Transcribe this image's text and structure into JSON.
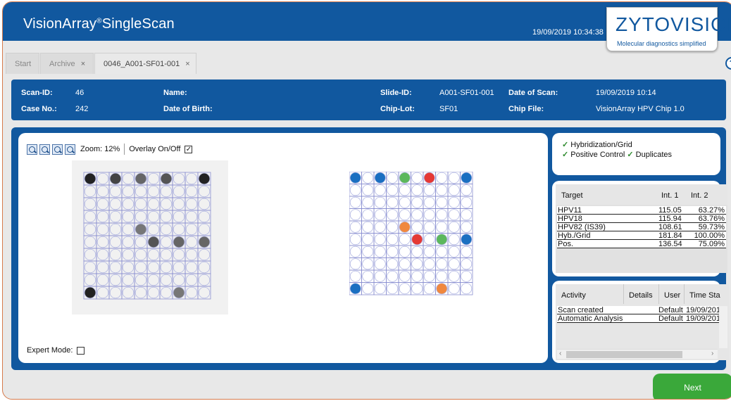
{
  "header": {
    "title": "VisionArray",
    "title_mark": "®",
    "title_suffix": "SingleScan",
    "datetime": "19/09/2019 10:34:38",
    "logo": {
      "word": "ZYTOVISION",
      "tagline": "Molecular diagnostics simplified"
    }
  },
  "tabs": [
    {
      "label": "Start",
      "closable": false,
      "active": false
    },
    {
      "label": "Archive",
      "closable": true,
      "active": false
    },
    {
      "label": "0046_A001-SF01-001",
      "closable": true,
      "active": true
    }
  ],
  "close_glyph": "×",
  "help_label": "?",
  "scan_info": {
    "scan_id_label": "Scan-ID:",
    "scan_id": "46",
    "case_no_label": "Case No.:",
    "case_no": "242",
    "name_label": "Name:",
    "name": "",
    "dob_label": "Date of Birth:",
    "dob": "",
    "slide_id_label": "Slide-ID:",
    "slide_id": "A001-SF01-001",
    "chip_lot_label": "Chip-Lot:",
    "chip_lot": "SF01",
    "date_of_scan_label": "Date of Scan:",
    "date_of_scan": "19/09/2019 10:14",
    "chip_file_label": "Chip File:",
    "chip_file": "VisionArray HPV Chip 1.0"
  },
  "viewer": {
    "zoom_label": "Zoom: 12%",
    "overlay_label": "Overlay On/Off",
    "overlay_checked": true,
    "expert_label": "Expert Mode:",
    "expert_checked": false,
    "grid_rows": 10,
    "grid_cols": 10,
    "raw_spots": [
      {
        "r": 0,
        "c": 0,
        "shade": "#222"
      },
      {
        "r": 0,
        "c": 2,
        "shade": "#444"
      },
      {
        "r": 0,
        "c": 4,
        "shade": "#666"
      },
      {
        "r": 0,
        "c": 6,
        "shade": "#555"
      },
      {
        "r": 0,
        "c": 9,
        "shade": "#222"
      },
      {
        "r": 4,
        "c": 4,
        "shade": "#777"
      },
      {
        "r": 5,
        "c": 5,
        "shade": "#555"
      },
      {
        "r": 5,
        "c": 7,
        "shade": "#666"
      },
      {
        "r": 5,
        "c": 9,
        "shade": "#666"
      },
      {
        "r": 9,
        "c": 0,
        "shade": "#222"
      },
      {
        "r": 9,
        "c": 7,
        "shade": "#777"
      }
    ],
    "spots": [
      {
        "r": 0,
        "c": 0,
        "color": "#1a6fc1"
      },
      {
        "r": 0,
        "c": 2,
        "color": "#1a6fc1"
      },
      {
        "r": 0,
        "c": 4,
        "color": "#5cb85c"
      },
      {
        "r": 0,
        "c": 6,
        "color": "#e53935"
      },
      {
        "r": 0,
        "c": 9,
        "color": "#1a6fc1"
      },
      {
        "r": 4,
        "c": 4,
        "color": "#f0883e"
      },
      {
        "r": 5,
        "c": 5,
        "color": "#e53935"
      },
      {
        "r": 5,
        "c": 7,
        "color": "#5cb85c"
      },
      {
        "r": 5,
        "c": 9,
        "color": "#1a6fc1"
      },
      {
        "r": 9,
        "c": 0,
        "color": "#1a6fc1"
      },
      {
        "r": 9,
        "c": 7,
        "color": "#f0883e"
      }
    ]
  },
  "status": {
    "line1": "Hybridization/Grid",
    "line2a": "Positive Control",
    "line2b": "Duplicates",
    "check_glyph": "✓"
  },
  "target_table": {
    "headers": [
      "Target",
      "Int. 1",
      "Int. 2"
    ],
    "rows": [
      [
        "HPV11",
        "115.05",
        "63.27%"
      ],
      [
        "HPV18",
        "115.94",
        "63.76%"
      ],
      [
        "HPV82 (IS39)",
        "108.61",
        "59.73%"
      ],
      [
        "Hyb./Grid",
        "181.84",
        "100.00%"
      ],
      [
        "Pos.",
        "136.54",
        "75.09%"
      ]
    ]
  },
  "activity_table": {
    "headers": [
      "Activity",
      "Details",
      "User",
      "Time Sta"
    ],
    "rows": [
      [
        "Scan created",
        "",
        "Default",
        "19/09/201"
      ],
      [
        "Automatic Analysis",
        "",
        "Default",
        "19/09/201"
      ]
    ]
  },
  "footer": {
    "next_label": "Next"
  },
  "colors": {
    "brand_blue": "#11589f",
    "accent_green": "#3aa83a"
  }
}
